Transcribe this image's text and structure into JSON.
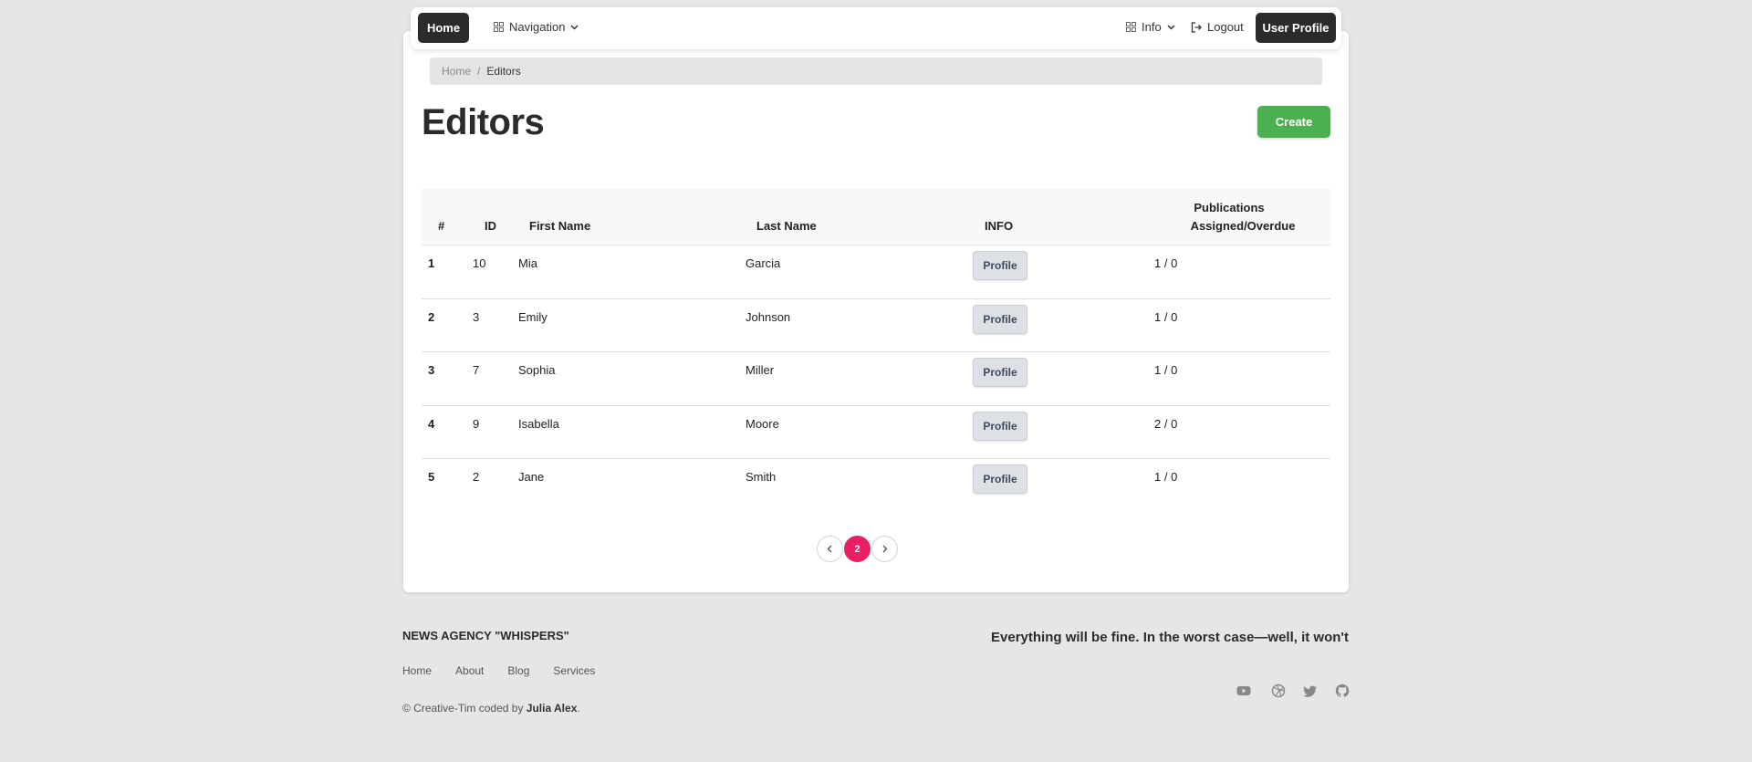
{
  "navbar": {
    "home_label": "Home",
    "navigation_label": "Navigation",
    "info_label": "Info",
    "logout_label": "Logout",
    "user_profile_label": "User Profile"
  },
  "breadcrumb": {
    "home": "Home",
    "separator": "/",
    "current": "Editors"
  },
  "page": {
    "title": "Editors",
    "create_label": "Create"
  },
  "table": {
    "headers": {
      "index": "#",
      "id": "ID",
      "first_name": "First Name",
      "last_name": "Last Name",
      "info": "INFO",
      "publications_line1": "Publications",
      "publications_line2": "Assigned/Overdue"
    },
    "rows": [
      {
        "index": "1",
        "id": "10",
        "first_name": "Mia",
        "last_name": "Garcia",
        "action": "Profile",
        "publications": "1 / 0"
      },
      {
        "index": "2",
        "id": "3",
        "first_name": "Emily",
        "last_name": "Johnson",
        "action": "Profile",
        "publications": "1 / 0"
      },
      {
        "index": "3",
        "id": "7",
        "first_name": "Sophia",
        "last_name": "Miller",
        "action": "Profile",
        "publications": "1 / 0"
      },
      {
        "index": "4",
        "id": "9",
        "first_name": "Isabella",
        "last_name": "Moore",
        "action": "Profile",
        "publications": "2 / 0"
      },
      {
        "index": "5",
        "id": "2",
        "first_name": "Jane",
        "last_name": "Smith",
        "action": "Profile",
        "publications": "1 / 0"
      }
    ]
  },
  "pagination": {
    "current_page": "2",
    "accent_color": "#e91e63"
  },
  "footer": {
    "brand": "NEWS AGENCY \"WHISPERS\"",
    "tagline": "Everything will be fine. In the worst case—well, it won't",
    "links": [
      "Home",
      "About",
      "Blog",
      "Services"
    ],
    "copyright_prefix": "© Creative-Tim coded by ",
    "copyright_author": "Julia Alex",
    "copyright_suffix": ".",
    "social_icons": [
      "youtube-icon",
      "dribbble-icon",
      "twitter-icon",
      "github-icon"
    ]
  },
  "colors": {
    "primary_dark": "#2b2b2b",
    "create_green": "#4caf50",
    "page_bg": "#e6e6e6"
  }
}
